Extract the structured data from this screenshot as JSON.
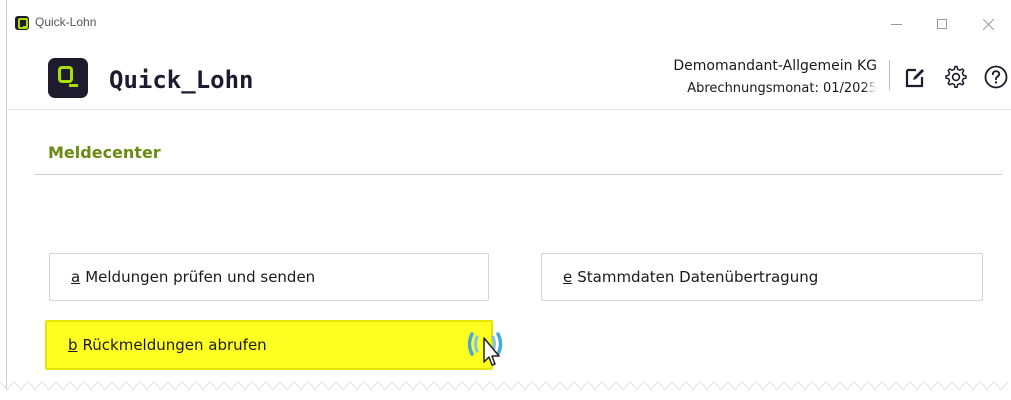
{
  "window": {
    "title": "Quick-Lohn",
    "controls": [
      "minimize-icon",
      "maximize-icon",
      "close-icon"
    ]
  },
  "header": {
    "brand": "Quick_Lohn",
    "client_name": "Demomandant-Allgemein KG",
    "billing_month": "Abrechnungsmonat: 01/2025",
    "icons": [
      "edit-icon",
      "gear-icon",
      "help-icon"
    ]
  },
  "section": {
    "title": "Meldecenter"
  },
  "actions": {
    "a": {
      "key": "a",
      "label": "Meldungen prüfen und senden"
    },
    "e": {
      "key": "e",
      "label": "Stammdaten Datenübertragung"
    },
    "b": {
      "key": "b",
      "label": "Rückmeldungen abrufen",
      "highlighted": true
    }
  },
  "colors": {
    "brand_dark": "#1e1b2e",
    "brand_accent": "#a8e000",
    "section_title": "#6b8a12",
    "highlight": "#ffff22"
  }
}
